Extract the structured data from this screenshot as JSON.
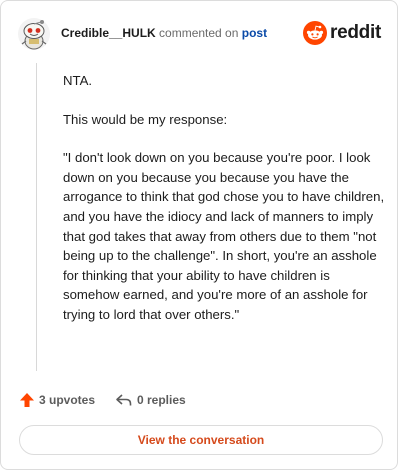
{
  "header": {
    "username": "Credible__HULK",
    "commented_on": "commented on",
    "post_link": "post",
    "logo_text": "reddit",
    "brand_color": "#ff4500"
  },
  "comment": {
    "paragraphs": [
      "NTA.",
      "This would be my response:",
      "\"I don't look down on you because you're poor. I look down on you because you because you have the arrogance to think that god chose you to have children, and you have the idiocy and lack of manners to imply that god takes that away from others due to them \"not being up to the challenge\". In short, you're an asshole for thinking that your ability to have children is somehow earned, and you're more of an asshole for trying to lord that over others.\""
    ]
  },
  "actions": {
    "upvotes": "3 upvotes",
    "replies": "0 replies",
    "upvote_color": "#ff4500"
  },
  "cta": {
    "label": "View the conversation",
    "color": "#d54a1c"
  },
  "icons": {
    "avatar": "snoo-avatar-icon",
    "logo": "reddit-logo-icon",
    "upvote": "upvote-arrow-icon",
    "reply": "reply-arrow-icon"
  }
}
